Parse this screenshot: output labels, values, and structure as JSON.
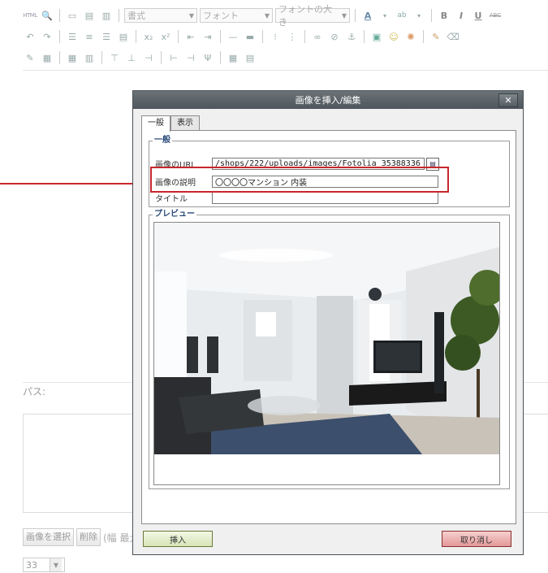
{
  "toolbar": {
    "html_tag": "HTML",
    "format_label": "書式",
    "font_label": "フォント",
    "font_size_label": "フォントの大き",
    "bold": "B",
    "italic": "I",
    "underline": "U",
    "strike": "ABC"
  },
  "editor": {
    "path_label": "パス:"
  },
  "bottom": {
    "select_image_button": "画像を選択",
    "delete_button": "削除",
    "width_hint": "(幅 最大",
    "page_select_value": "33"
  },
  "dialog": {
    "title": "画像を挿入/編集",
    "close_glyph": "✕",
    "tabs": [
      {
        "label": "一般",
        "active": true
      },
      {
        "label": "表示",
        "active": false
      }
    ],
    "general_legend": "一般",
    "fields": {
      "url_label": "画像のURL",
      "url_value": "/shops/222/uploads/images/Fotolia_35388336",
      "description_label": "画像の説明",
      "description_value": "〇〇〇〇マンション 内装",
      "title_label": "タイトル",
      "title_value": ""
    },
    "preview_legend": "プレビュー",
    "insert_button": "挿入",
    "cancel_button": "取り消し"
  },
  "colors": {
    "highlight": "#c8262d",
    "title_bar": "#5a6166",
    "legend_text": "#2a4a7a"
  }
}
